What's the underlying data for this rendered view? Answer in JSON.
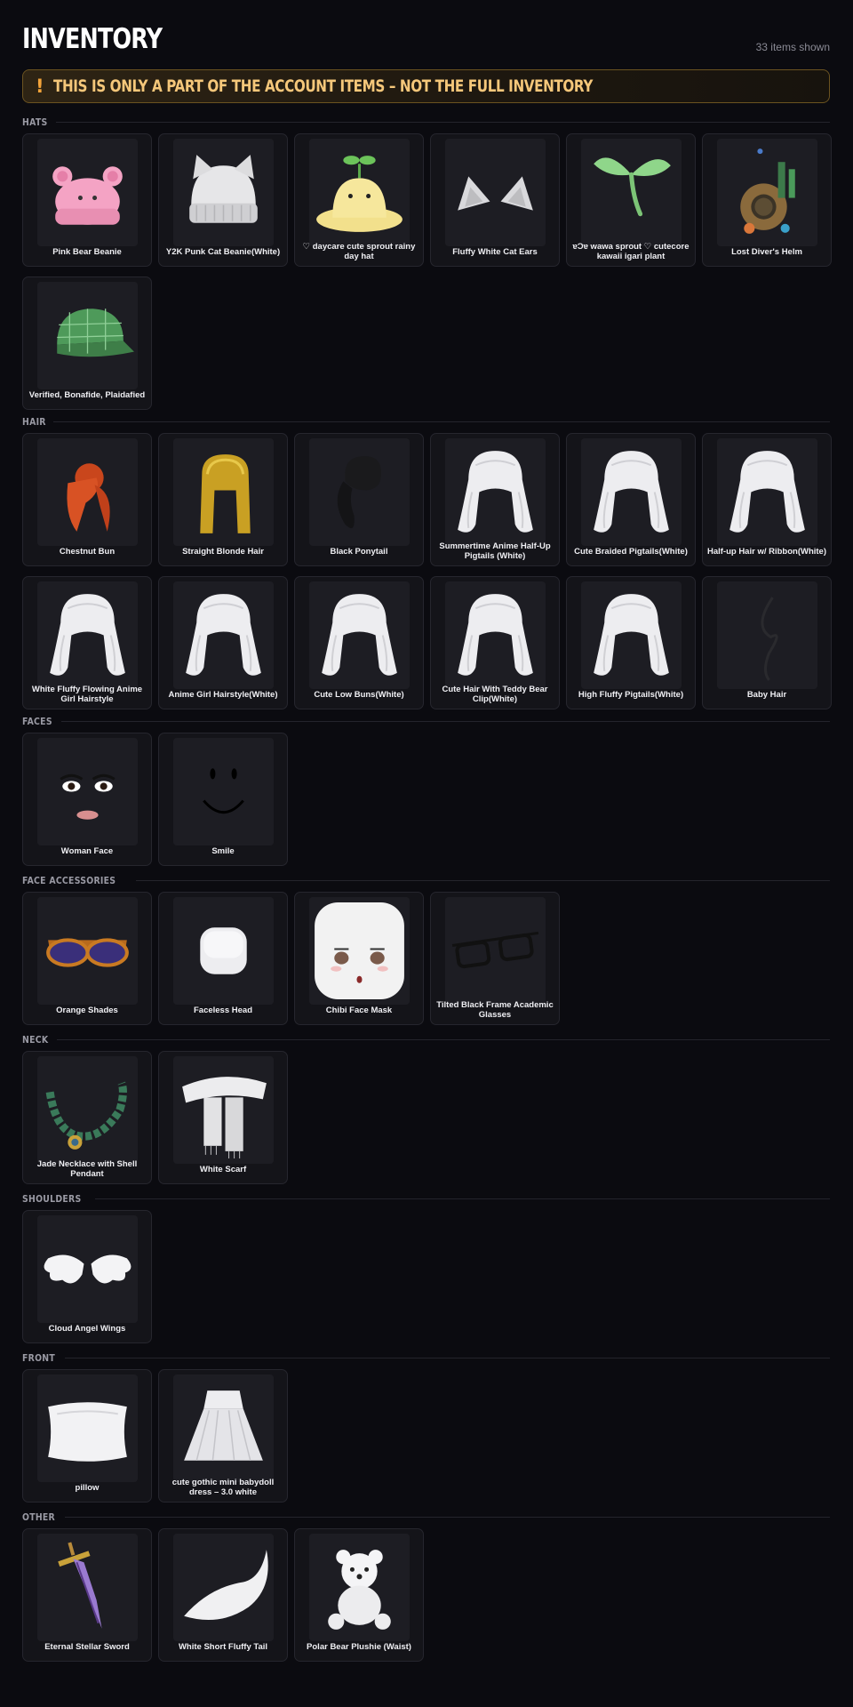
{
  "header": {
    "title": "INVENTORY",
    "count": "33 items shown"
  },
  "warning": {
    "icon": "!",
    "text": "THIS IS ONLY A PART OF THE ACCOUNT ITEMS – NOT THE FULL INVENTORY"
  },
  "sections": [
    {
      "label": "HATS",
      "items": [
        {
          "name": "Pink Bear Beanie",
          "icon": "pink-bear-beanie"
        },
        {
          "name": "Y2K Punk Cat Beanie(White)",
          "icon": "cat-beanie"
        },
        {
          "name": "♡ daycare cute sprout rainy day hat",
          "icon": "sprout-hat"
        },
        {
          "name": "Fluffy White Cat Ears",
          "icon": "cat-ears"
        },
        {
          "name": "ɐƆɐ wawa sprout ♡ cutecore kawaii igari plant",
          "icon": "sprout"
        },
        {
          "name": "Lost Diver's Helm",
          "icon": "diver-helm"
        },
        {
          "name": "Verified, Bonafide, Plaidafied",
          "icon": "plaid-cap"
        }
      ]
    },
    {
      "label": "HAIR",
      "items": [
        {
          "name": "Chestnut Bun",
          "icon": "chestnut-bun"
        },
        {
          "name": "Straight Blonde Hair",
          "icon": "blonde-hair"
        },
        {
          "name": "Black Ponytail",
          "icon": "black-ponytail"
        },
        {
          "name": "Summertime Anime Half-Up Pigtails (White)",
          "icon": "white-hair"
        },
        {
          "name": "Cute Braided Pigtails(White)",
          "icon": "white-hair"
        },
        {
          "name": "Half-up Hair w/ Ribbon(White)",
          "icon": "white-hair"
        },
        {
          "name": "White Fluffy Flowing Anime Girl Hairstyle",
          "icon": "white-hair"
        },
        {
          "name": "Anime Girl Hairstyle(White)",
          "icon": "white-hair"
        },
        {
          "name": "Cute Low Buns(White)",
          "icon": "white-hair"
        },
        {
          "name": "Cute Hair With Teddy Bear Clip(White)",
          "icon": "white-hair"
        },
        {
          "name": "High Fluffy Pigtails(White)",
          "icon": "white-hair"
        },
        {
          "name": "Baby Hair",
          "icon": "baby-hair"
        }
      ]
    },
    {
      "label": "FACES",
      "items": [
        {
          "name": "Woman Face",
          "icon": "woman-face"
        },
        {
          "name": "Smile",
          "icon": "smile-face"
        }
      ]
    },
    {
      "label": "FACE ACCESSORIES",
      "items": [
        {
          "name": "Orange Shades",
          "icon": "orange-shades"
        },
        {
          "name": "Faceless Head",
          "icon": "faceless-head"
        },
        {
          "name": "Chibi Face Mask",
          "icon": "chibi-mask"
        },
        {
          "name": "Tilted Black Frame Academic Glasses",
          "icon": "black-glasses"
        }
      ]
    },
    {
      "label": "NECK",
      "items": [
        {
          "name": "Jade Necklace with Shell Pendant",
          "icon": "jade-necklace"
        },
        {
          "name": "White Scarf",
          "icon": "white-scarf"
        }
      ]
    },
    {
      "label": "SHOULDERS",
      "items": [
        {
          "name": "Cloud Angel Wings",
          "icon": "angel-wings"
        }
      ]
    },
    {
      "label": "FRONT",
      "items": [
        {
          "name": "pillow",
          "icon": "pillow"
        },
        {
          "name": "cute gothic mini babydoll dress – 3.0 white",
          "icon": "white-dress"
        }
      ]
    },
    {
      "label": "OTHER",
      "items": [
        {
          "name": "Eternal Stellar Sword",
          "icon": "sword"
        },
        {
          "name": "White Short Fluffy Tail",
          "icon": "white-tail"
        },
        {
          "name": "Polar Bear Plushie (Waist)",
          "icon": "polar-bear"
        }
      ]
    }
  ]
}
